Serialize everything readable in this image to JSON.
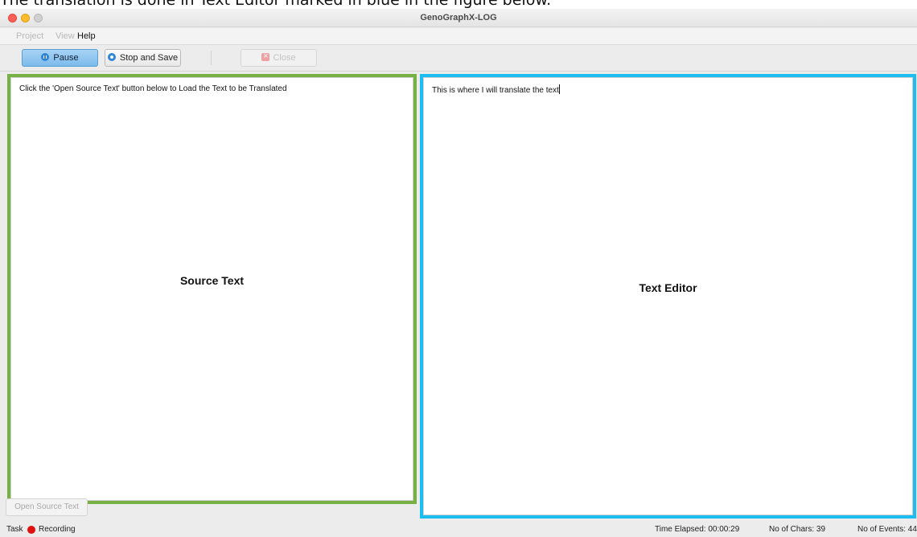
{
  "caption": "The translation is done in Text Editor marked in blue in the figure below.",
  "window": {
    "title": "GenoGraphX-LOG"
  },
  "menu": {
    "items": [
      "Project",
      "View",
      "Help"
    ]
  },
  "toolbar": {
    "pause_label": "Pause",
    "stop_save_label": "Stop and Save",
    "close_label": "Close"
  },
  "source_pane": {
    "instruction": "Click the 'Open Source Text' button below to Load the Text to be Translated",
    "label": "Source Text",
    "highlight_color": "#77b043"
  },
  "editor_pane": {
    "content": "This is where I will translate the text",
    "label": "Text Editor",
    "highlight_color": "#1cbdf0"
  },
  "open_source_button": "Open Source Text",
  "status": {
    "task": "Task",
    "recording": "Recording",
    "time_elapsed": "Time Elapsed:  00:00:29",
    "chars": "No of Chars:  39",
    "events": "No of Events:  44"
  },
  "icons": {
    "pause": "pause-icon",
    "stop": "stop-icon",
    "close": "close-icon",
    "recording": "record-dot-icon"
  }
}
